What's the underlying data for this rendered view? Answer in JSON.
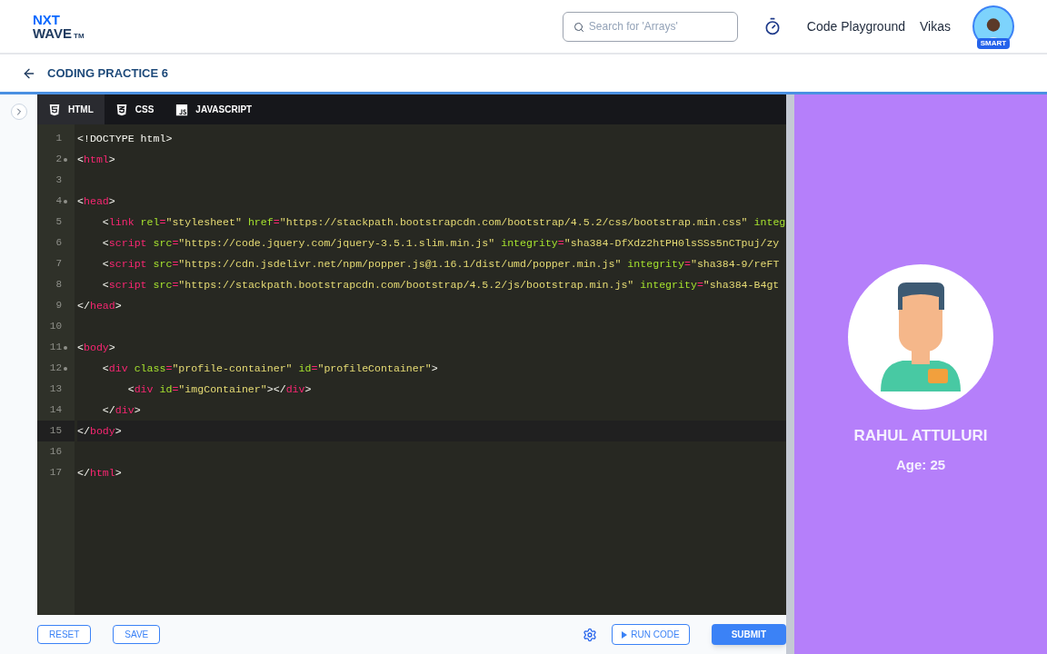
{
  "header": {
    "logo": {
      "top": "NXT",
      "bottom": "WAVE",
      "mark": "TM"
    },
    "search": {
      "placeholder": "Search for 'Arrays'"
    },
    "links": [
      "Code Playground",
      "Vikas"
    ],
    "avatar_badge": "SMART"
  },
  "page": {
    "title": "CODING PRACTICE 6"
  },
  "editor": {
    "tabs": [
      {
        "label": "HTML",
        "kind": "html",
        "selected": true
      },
      {
        "label": "CSS",
        "kind": "css",
        "selected": false
      },
      {
        "label": "JAVASCRIPT",
        "kind": "js",
        "selected": false
      }
    ],
    "lines": [
      {
        "number": "1",
        "foldable": false,
        "active": false,
        "tokens": [
          {
            "kind": "text",
            "t": "<!DOCTYPE html>"
          }
        ]
      },
      {
        "number": "2",
        "foldable": true,
        "active": false,
        "tokens": [
          {
            "kind": "punct",
            "t": "<"
          },
          {
            "kind": "tag",
            "t": "html"
          },
          {
            "kind": "punct",
            "t": ">"
          }
        ]
      },
      {
        "number": "3",
        "foldable": false,
        "active": false
      },
      {
        "number": "4",
        "foldable": true,
        "active": false,
        "tokens": [
          {
            "kind": "punct",
            "t": "<"
          },
          {
            "kind": "tag",
            "t": "head"
          },
          {
            "kind": "punct",
            "t": ">"
          }
        ]
      },
      {
        "number": "5",
        "foldable": false,
        "active": false,
        "tokens": [
          {
            "kind": "punct",
            "t": "    <"
          },
          {
            "kind": "tag",
            "t": "link"
          },
          {
            "kind": "attr",
            "t": " rel"
          },
          {
            "kind": "eq",
            "t": "="
          },
          {
            "kind": "str",
            "t": "\"stylesheet\""
          },
          {
            "kind": "attr",
            "t": " href"
          },
          {
            "kind": "eq",
            "t": "="
          },
          {
            "kind": "str",
            "t": "\"https://stackpath.bootstrapcdn.com/bootstrap/4.5.2/css/bootstrap.min.css\""
          },
          {
            "kind": "attr",
            "t": " integ"
          }
        ]
      },
      {
        "number": "6",
        "foldable": false,
        "active": false,
        "tokens": [
          {
            "kind": "punct",
            "t": "    <"
          },
          {
            "kind": "tag",
            "t": "script"
          },
          {
            "kind": "attr",
            "t": " src"
          },
          {
            "kind": "eq",
            "t": "="
          },
          {
            "kind": "str",
            "t": "\"https://code.jquery.com/jquery-3.5.1.slim.min.js\""
          },
          {
            "kind": "attr",
            "t": " integrity"
          },
          {
            "kind": "eq",
            "t": "="
          },
          {
            "kind": "str",
            "t": "\"sha384-DfXdz2htPH0lsSSs5nCTpuj/zy"
          }
        ]
      },
      {
        "number": "7",
        "foldable": false,
        "active": false,
        "tokens": [
          {
            "kind": "punct",
            "t": "    <"
          },
          {
            "kind": "tag",
            "t": "script"
          },
          {
            "kind": "attr",
            "t": " src"
          },
          {
            "kind": "eq",
            "t": "="
          },
          {
            "kind": "str",
            "t": "\"https://cdn.jsdelivr.net/npm/popper.js@1.16.1/dist/umd/popper.min.js\""
          },
          {
            "kind": "attr",
            "t": " integrity"
          },
          {
            "kind": "eq",
            "t": "="
          },
          {
            "kind": "str",
            "t": "\"sha384-9/reFT"
          }
        ]
      },
      {
        "number": "8",
        "foldable": false,
        "active": false,
        "tokens": [
          {
            "kind": "punct",
            "t": "    <"
          },
          {
            "kind": "tag",
            "t": "script"
          },
          {
            "kind": "attr",
            "t": " src"
          },
          {
            "kind": "eq",
            "t": "="
          },
          {
            "kind": "str",
            "t": "\"https://stackpath.bootstrapcdn.com/bootstrap/4.5.2/js/bootstrap.min.js\""
          },
          {
            "kind": "attr",
            "t": " integrity"
          },
          {
            "kind": "eq",
            "t": "="
          },
          {
            "kind": "str",
            "t": "\"sha384-B4gt"
          }
        ]
      },
      {
        "number": "9",
        "foldable": false,
        "active": false,
        "tokens": [
          {
            "kind": "punct",
            "t": "</"
          },
          {
            "kind": "tag",
            "t": "head"
          },
          {
            "kind": "punct",
            "t": ">"
          }
        ]
      },
      {
        "number": "10",
        "foldable": false,
        "active": false
      },
      {
        "number": "11",
        "foldable": true,
        "active": false,
        "tokens": [
          {
            "kind": "punct",
            "t": "<"
          },
          {
            "kind": "tag",
            "t": "body"
          },
          {
            "kind": "punct",
            "t": ">"
          }
        ]
      },
      {
        "number": "12",
        "foldable": true,
        "active": false,
        "tokens": [
          {
            "kind": "punct",
            "t": "    <"
          },
          {
            "kind": "tag",
            "t": "div"
          },
          {
            "kind": "attr",
            "t": " class"
          },
          {
            "kind": "eq",
            "t": "="
          },
          {
            "kind": "str",
            "t": "\"profile-container\""
          },
          {
            "kind": "attr",
            "t": " id"
          },
          {
            "kind": "eq",
            "t": "="
          },
          {
            "kind": "str",
            "t": "\"profileContainer\""
          },
          {
            "kind": "punct",
            "t": ">"
          }
        ]
      },
      {
        "number": "13",
        "foldable": false,
        "active": false,
        "tokens": [
          {
            "kind": "punct",
            "t": "        <"
          },
          {
            "kind": "tag",
            "t": "div"
          },
          {
            "kind": "attr",
            "t": " id"
          },
          {
            "kind": "eq",
            "t": "="
          },
          {
            "kind": "str",
            "t": "\"imgContainer\""
          },
          {
            "kind": "punct",
            "t": "></"
          },
          {
            "kind": "tag",
            "t": "div"
          },
          {
            "kind": "punct",
            "t": ">"
          }
        ]
      },
      {
        "number": "14",
        "foldable": false,
        "active": false,
        "tokens": [
          {
            "kind": "punct",
            "t": "    </"
          },
          {
            "kind": "tag",
            "t": "div"
          },
          {
            "kind": "punct",
            "t": ">"
          }
        ]
      },
      {
        "number": "15",
        "foldable": false,
        "active": true,
        "tokens": [
          {
            "kind": "punct",
            "t": "</"
          },
          {
            "kind": "tag",
            "t": "body"
          },
          {
            "kind": "punct",
            "t": ">"
          }
        ]
      },
      {
        "number": "16",
        "foldable": false,
        "active": false
      },
      {
        "number": "17",
        "foldable": false,
        "active": false,
        "tokens": [
          {
            "kind": "punct",
            "t": "</"
          },
          {
            "kind": "tag",
            "t": "html"
          },
          {
            "kind": "punct",
            "t": ">"
          }
        ]
      }
    ]
  },
  "actions": {
    "left": [
      "RESET",
      "SAVE"
    ],
    "run": "RUN CODE",
    "submit": "SUBMIT"
  },
  "preview": {
    "name": "RAHUL ATTULURI",
    "age": "Age: 25"
  }
}
